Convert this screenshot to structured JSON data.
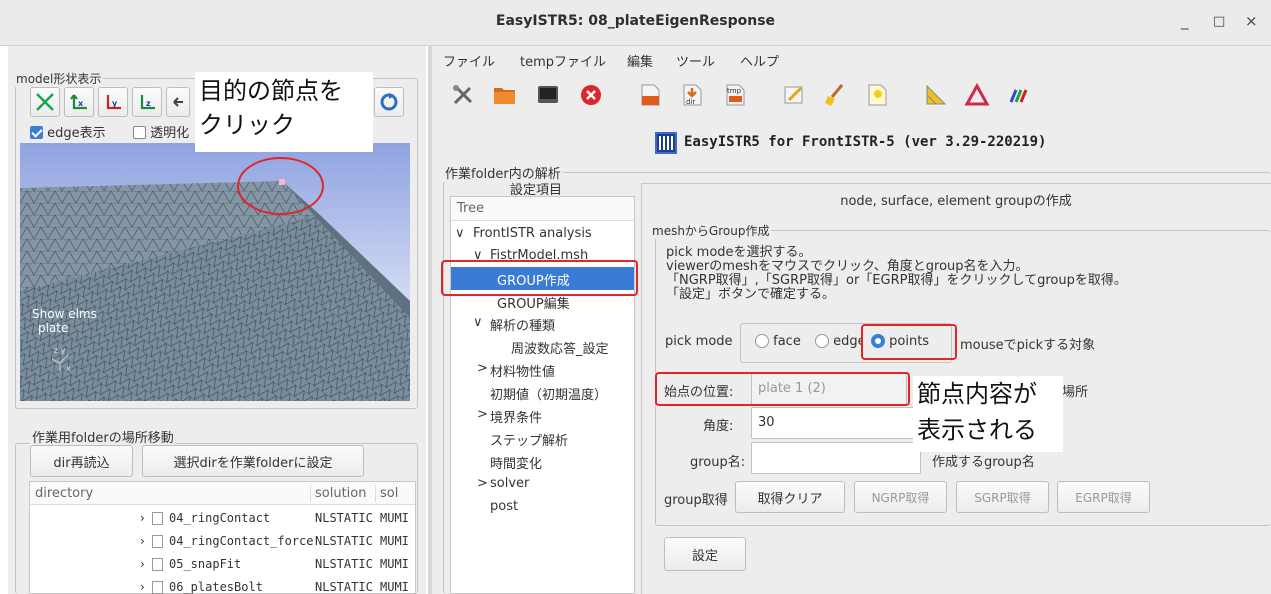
{
  "window": {
    "title": "EasyISTR5: 08_plateEigenResponse",
    "controls": [
      "_",
      "□",
      "×"
    ]
  },
  "left": {
    "model_view": {
      "group_title": "model形状表示",
      "edge_checkbox": "edge表示",
      "transparent_checkbox": "透明化",
      "viewer_overlay_text": "Show elms\nplate",
      "triad_label": "z y\nx"
    },
    "callout_click": "目的の節点を\nクリック",
    "folder": {
      "group_title": "作業用folderの場所移動",
      "reload_button": "dir再読込",
      "set_button": "選択dirを作業folderに設定",
      "columns": [
        "directory",
        "solution",
        "sol"
      ],
      "rows": [
        {
          "name": "04_ringContact",
          "solution": "NLSTATIC",
          "sol": "MUMI"
        },
        {
          "name": "04_ringContact_force",
          "solution": "NLSTATIC",
          "sol": "MUMI"
        },
        {
          "name": "05_snapFit",
          "solution": "NLSTATIC",
          "sol": "MUMI"
        },
        {
          "name": "06_platesBolt",
          "solution": "NLSTATIC",
          "sol": "MUMI"
        }
      ]
    }
  },
  "right": {
    "menu": [
      "ファイル",
      "tempファイル",
      "編集",
      "ツール",
      "ヘルプ"
    ],
    "toolbar_tmp_label": "tmp",
    "toolbar_dir_label": "dir",
    "app_banner": "EasyISTR5 for FrontISTR-5  (ver 3.29-220219)",
    "analysis_group_title": "作業folder内の解析",
    "settings_label": "設定項目",
    "tree_header": "Tree",
    "tree": [
      {
        "label": "FrontISTR analysis",
        "arrow": "∨"
      },
      {
        "label": "FistrModel.msh",
        "arrow": "∨"
      },
      {
        "label": "GROUP作成",
        "arrow": ""
      },
      {
        "label": "GROUP編集",
        "arrow": ""
      },
      {
        "label": "解析の種類",
        "arrow": "∨"
      },
      {
        "label": "周波数応答_設定",
        "arrow": ""
      },
      {
        "label": "材料物性値",
        "arrow": ">"
      },
      {
        "label": "初期値（初期温度）",
        "arrow": ""
      },
      {
        "label": "境界条件",
        "arrow": ">"
      },
      {
        "label": "ステップ解析",
        "arrow": ""
      },
      {
        "label": "時間変化",
        "arrow": ""
      },
      {
        "label": "solver",
        "arrow": ">"
      },
      {
        "label": "post",
        "arrow": ""
      }
    ],
    "panel": {
      "heading": "node, surface, element groupの作成",
      "mesh_group_title": "meshからGroup作成",
      "instructions": [
        "pick modeを選択する。",
        "viewerのmeshをマウスでクリック、角度とgroup名を入力。",
        "「NGRP取得」,「SGRP取得」or「EGRP取得」をクリックしてgroupを取得。",
        "「設定」ボタンで確定する。"
      ],
      "pick_mode_label": "pick mode",
      "pick_options": [
        "face",
        "edge",
        "points"
      ],
      "pick_selected": "points",
      "pick_hint": "mouseでpickする対象",
      "start_label": "始点の位置:",
      "start_value": "plate 1 (2)",
      "start_hint_partial": "場所",
      "angle_label": "角度:",
      "angle_value": "30",
      "group_name_label": "group名:",
      "group_name_value": "",
      "group_name_hint": "作成するgroup名",
      "group_get_label": "group取得",
      "clear_button": "取得クリア",
      "ngrp_button": "NGRP取得",
      "sgrp_button": "SGRP取得",
      "egrp_button": "EGRP取得",
      "set_button": "設定"
    },
    "callout_node": "節点内容が\n表示される"
  },
  "colors": {
    "accent": "#3b7ed8",
    "highlight": "#e0262a",
    "tree_selected": "#3a7bd5"
  }
}
